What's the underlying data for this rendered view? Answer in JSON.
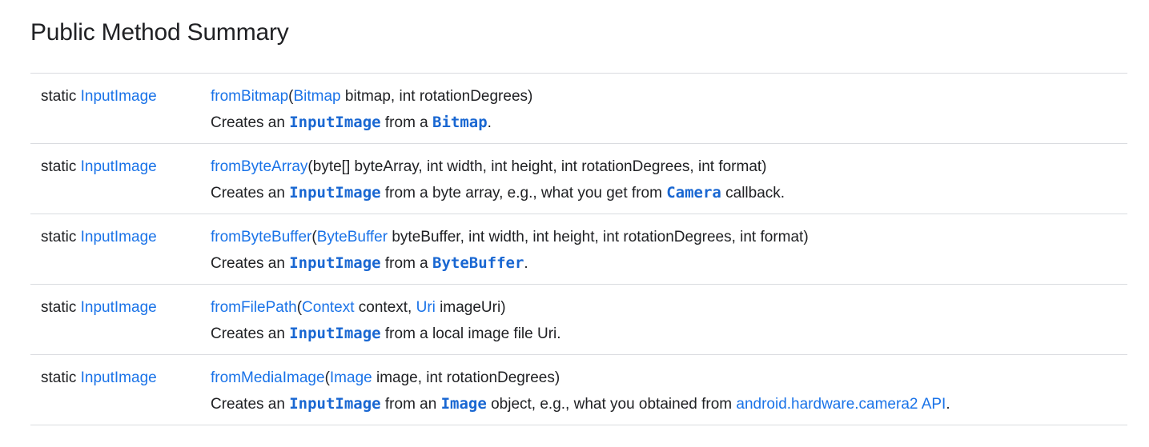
{
  "section": {
    "title": "Public Method Summary"
  },
  "methods": [
    {
      "modifier": "static",
      "return_type": "InputImage",
      "name": "fromBitmap",
      "params_open": "(",
      "p1_type": "Bitmap",
      "p1_rest": " bitmap, int rotationDegrees)",
      "desc_prefix": "Creates an ",
      "desc_code1": "InputImage",
      "desc_mid": " from a ",
      "desc_code2": "Bitmap",
      "desc_suffix": "."
    },
    {
      "modifier": "static",
      "return_type": "InputImage",
      "name": "fromByteArray",
      "params": "(byte[] byteArray, int width, int height, int rotationDegrees, int format)",
      "desc_prefix": "Creates an ",
      "desc_code1": "InputImage",
      "desc_mid": " from a byte array, e.g., what you get from ",
      "desc_code2": "Camera",
      "desc_suffix": " callback."
    },
    {
      "modifier": "static",
      "return_type": "InputImage",
      "name": "fromByteBuffer",
      "params_open": "(",
      "p1_type": "ByteBuffer",
      "p1_rest": " byteBuffer, int width, int height, int rotationDegrees, int format)",
      "desc_prefix": "Creates an ",
      "desc_code1": "InputImage",
      "desc_mid": " from a ",
      "desc_code2": "ByteBuffer",
      "desc_suffix": "."
    },
    {
      "modifier": "static",
      "return_type": "InputImage",
      "name": "fromFilePath",
      "params_open": "(",
      "p1_type": "Context",
      "p1_rest": " context, ",
      "p2_type": "Uri",
      "p2_rest": " imageUri)",
      "desc_prefix": "Creates an ",
      "desc_code1": "InputImage",
      "desc_suffix": " from a local image file Uri."
    },
    {
      "modifier": "static",
      "return_type": "InputImage",
      "name": "fromMediaImage",
      "params_open": "(",
      "p1_type": "Image",
      "p1_rest": " image, int rotationDegrees)",
      "desc_prefix": "Creates an ",
      "desc_code1": "InputImage",
      "desc_mid": " from an ",
      "desc_code2": "Image",
      "desc_mid2": " object, e.g., what you obtained from ",
      "desc_link": "android.hardware.camera2 API",
      "desc_suffix": "."
    }
  ]
}
